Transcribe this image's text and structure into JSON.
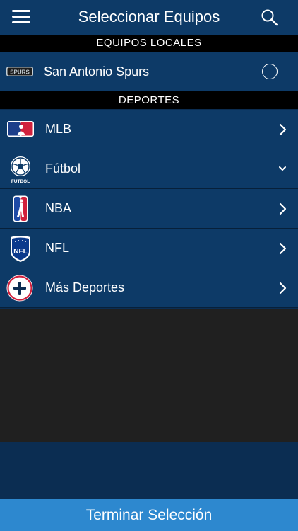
{
  "header": {
    "title": "Seleccionar Equipos",
    "menu_icon": "hamburger-menu-icon",
    "search_icon": "search-icon"
  },
  "local_section": {
    "title": "EQUIPOS LOCALES",
    "team": {
      "name": "San Antonio Spurs",
      "logo_text": "SPURS",
      "action_icon": "add-circle-icon"
    }
  },
  "sports_section": {
    "title": "DEPORTES",
    "items": [
      {
        "label": "MLB",
        "icon": "mlb-logo-icon",
        "indicator": "chevron-right-icon"
      },
      {
        "label": "Fútbol",
        "icon": "soccer-ball-icon",
        "icon_caption": "FUTBOL",
        "indicator": "chevron-down-icon"
      },
      {
        "label": "NBA",
        "icon": "nba-logo-icon",
        "indicator": "chevron-right-icon"
      },
      {
        "label": "NFL",
        "icon": "nfl-logo-icon",
        "icon_caption": "NFL",
        "indicator": "chevron-right-icon"
      },
      {
        "label": "Más Deportes",
        "icon": "plus-circle-icon",
        "indicator": "chevron-right-icon"
      }
    ]
  },
  "footer": {
    "button_label": "Terminar Selección"
  },
  "colors": {
    "header_bg": "#0d3a67",
    "row_bg": "#0d3a67",
    "section_header_bg": "#000000",
    "empty_bg": "#202020",
    "button_bg": "#2d88cf"
  }
}
